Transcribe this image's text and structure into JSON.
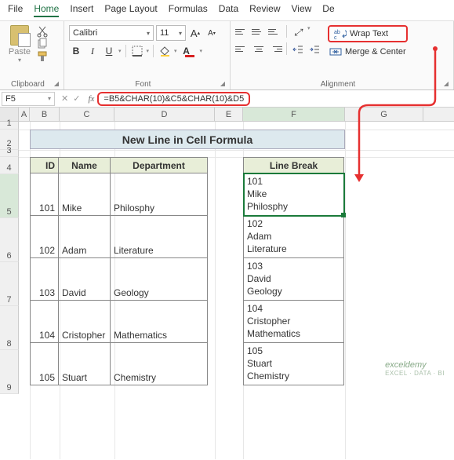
{
  "menu": {
    "file": "File",
    "home": "Home",
    "insert": "Insert",
    "page_layout": "Page Layout",
    "formulas": "Formulas",
    "data": "Data",
    "review": "Review",
    "view": "View",
    "de": "De"
  },
  "ribbon": {
    "clipboard": {
      "paste": "Paste",
      "label": "Clipboard"
    },
    "font": {
      "name": "Calibri",
      "size": "11",
      "label": "Font",
      "bold": "B",
      "italic": "I",
      "underline": "U",
      "inc": "A",
      "dec": "A"
    },
    "alignment": {
      "wrap": "Wrap Text",
      "merge": "Merge & Center",
      "label": "Alignment"
    }
  },
  "namebox": "F5",
  "formula": "=B5&CHAR(10)&C5&CHAR(10)&D5",
  "cols": [
    "A",
    "B",
    "C",
    "D",
    "E",
    "F",
    "G"
  ],
  "title": "New Line in Cell Formula",
  "headers": {
    "id": "ID",
    "name": "Name",
    "dept": "Department",
    "lb": "Line Break"
  },
  "rows": [
    {
      "id": "101",
      "name": "Mike",
      "dept": "Philosphy",
      "lb": "101\nMike\nPhilosphy"
    },
    {
      "id": "102",
      "name": "Adam",
      "dept": "Literature",
      "lb": "102\nAdam\nLiterature"
    },
    {
      "id": "103",
      "name": "David",
      "dept": "Geology",
      "lb": "103\nDavid\nGeology"
    },
    {
      "id": "104",
      "name": "Cristopher",
      "dept": "Mathematics",
      "lb": "104\nCristopher\nMathematics"
    },
    {
      "id": "105",
      "name": "Stuart",
      "dept": "Chemistry",
      "lb": "105\nStuart\nChemistry"
    }
  ],
  "watermark": {
    "main": "exceldemy",
    "sub": "EXCEL · DATA · BI"
  }
}
